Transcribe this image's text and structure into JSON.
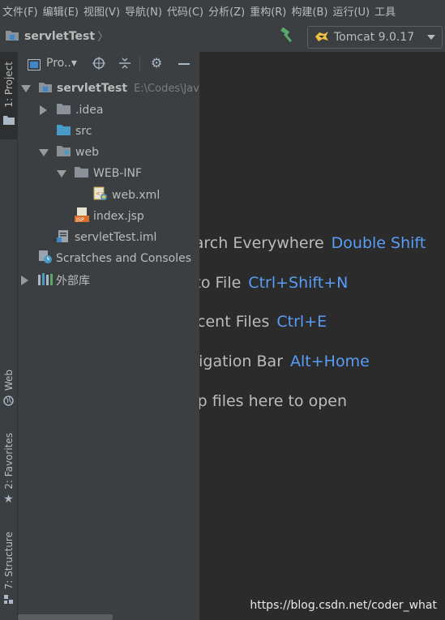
{
  "menubar": {
    "items": [
      "文件(F)",
      "编辑(E)",
      "视图(V)",
      "导航(N)",
      "代码(C)",
      "分析(Z)",
      "重构(R)",
      "构建(B)",
      "运行(U)",
      "工具"
    ]
  },
  "toolbar": {
    "breadcrumb": "servletTest",
    "run_config": "Tomcat 9.0.17"
  },
  "left_strip": {
    "project_tab": "1: Project",
    "web_tab": "Web",
    "favorites_tab": "2: Favorites",
    "structure_tab": "7: Structure"
  },
  "panel": {
    "title": "Pro..▾"
  },
  "tree": {
    "root_name": "servletTest",
    "root_path": "E:\\Codes\\Jav",
    "idea": ".idea",
    "src": "src",
    "web": "web",
    "webinf": "WEB-INF",
    "webxml": "web.xml",
    "indexjsp": "index.jsp",
    "iml": "servletTest.iml",
    "scratches": "Scratches and Consoles",
    "extlib": "外部库"
  },
  "editor": {
    "hints": [
      {
        "text": "Search Everywhere",
        "shortcut": "Double Shift"
      },
      {
        "text": "Go to File",
        "shortcut": "Ctrl+Shift+N"
      },
      {
        "text": "Recent Files",
        "shortcut": "Ctrl+E"
      },
      {
        "text": "Navigation Bar",
        "shortcut": "Alt+Home"
      },
      {
        "text": "Drop files here to open",
        "shortcut": ""
      }
    ]
  },
  "watermark": "https://blog.csdn.net/coder_what",
  "colors": {
    "accent": "#589df6",
    "background": "#2b2b2b",
    "panel": "#3c3f41"
  }
}
